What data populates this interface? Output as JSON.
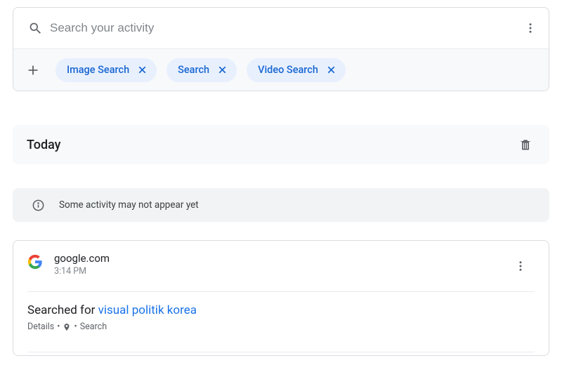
{
  "search": {
    "placeholder": "Search your activity"
  },
  "chips": [
    {
      "label": "Image Search"
    },
    {
      "label": "Search"
    },
    {
      "label": "Video Search"
    }
  ],
  "section": {
    "title": "Today"
  },
  "notice": {
    "text": "Some activity may not appear yet"
  },
  "entry": {
    "domain": "google.com",
    "time": "3:14 PM",
    "prefix": "Searched for ",
    "query": "visual politik korea",
    "details_label": "Details",
    "category": "Search"
  }
}
